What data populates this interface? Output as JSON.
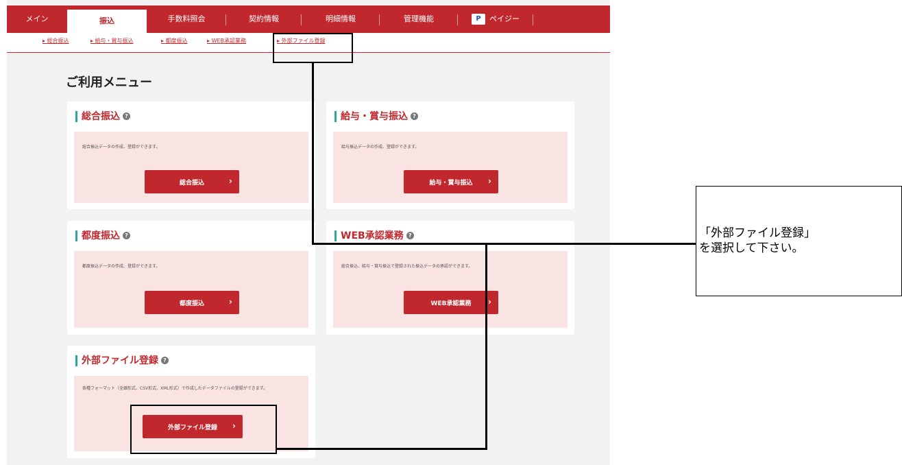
{
  "nav": {
    "items": [
      {
        "label": "メイン"
      },
      {
        "label": "振込"
      },
      {
        "label": "手数料照会"
      },
      {
        "label": "契約情報"
      },
      {
        "label": "明細情報"
      },
      {
        "label": "管理機能"
      },
      {
        "label": "ペイジー"
      }
    ],
    "active_index": 1
  },
  "subnav": {
    "items": [
      {
        "label": "総合振込"
      },
      {
        "label": "給与・賞与振込"
      },
      {
        "label": "都度振込"
      },
      {
        "label": "WEB承認業務"
      },
      {
        "label": "外部ファイル登録"
      }
    ]
  },
  "page": {
    "title": "ご利用メニュー"
  },
  "cards": [
    {
      "title": "総合振込",
      "desc": "総合振込データの作成、登録ができます。",
      "button": "総合振込"
    },
    {
      "title": "給与・賞与振込",
      "desc": "給与振込データの作成、登録ができます。",
      "button": "給与・賞与振込"
    },
    {
      "title": "都度振込",
      "desc": "都度振込データの作成、登録ができます。",
      "button": "都度振込"
    },
    {
      "title": "WEB承認業務",
      "desc": "総合振込、給与・賞与振込で登録された振込データの承認ができます。",
      "button": "WEB承認業務"
    },
    {
      "title": "外部ファイル登録",
      "desc": "各種フォーマット（全銀形式、CSV形式、XML形式）で作成したデータファイルの登録ができます。",
      "button": "外部ファイル登録"
    }
  ],
  "icons": {
    "help": "help-icon",
    "chevron": "chevron-right-icon",
    "pay": "pay-easy-icon"
  },
  "callout": {
    "line1": "「外部ファイル登録」",
    "line2": "を選択して下さい。"
  },
  "colors": {
    "brand": "#c0282d",
    "card_body": "#fae3e3",
    "accent_bar": "#2ba6a0"
  }
}
